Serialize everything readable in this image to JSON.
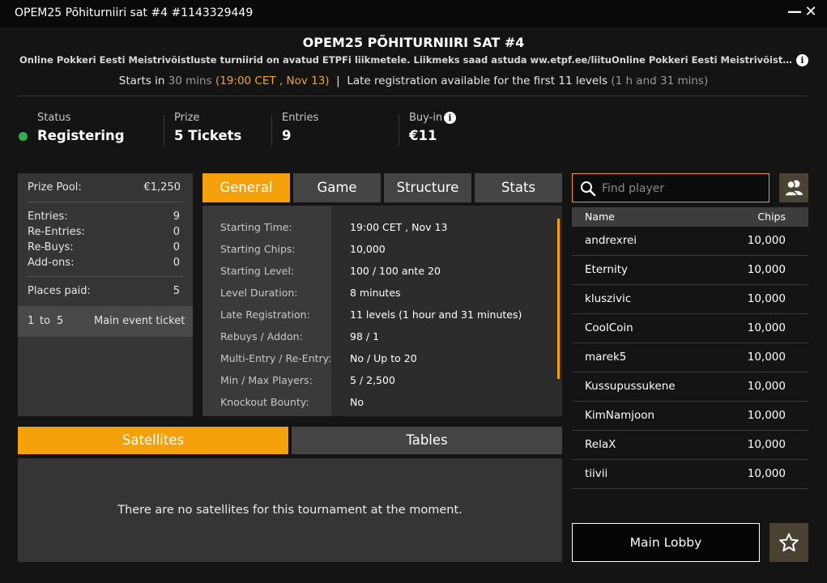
{
  "window": {
    "title": "OPEM25 Põhiturniiri sat #4 #1143329449",
    "minimize": "—",
    "close": "✕"
  },
  "header": {
    "title": "OPEM25 PÕHITURNIIRI SAT #4",
    "description": "Online Pokkeri Eesti Meistrivõistluste turniirid on avatud ETPFi liikmetele. Liikmeks saad astuda ww.etpf.ee/liituOnline Pokkeri Eesti Meistrivõistluste turniirid on avatud ETPFi liikmetele.",
    "starts_label": "Starts in",
    "starts_in": "30 mins",
    "start_time": "(19:00 CET , Nov 13)",
    "divider": "|",
    "late_reg_text": "Late registration available for the first 11 levels",
    "late_reg_time": "(1 h and 31 mins)"
  },
  "summary": {
    "status_label": "Status",
    "status_value": "Registering",
    "status_color": "#2bb24c",
    "prize_label": "Prize",
    "prize_value": "5 Tickets",
    "entries_label": "Entries",
    "entries_value": "9",
    "buyin_label": "Buy-in",
    "buyin_value": "€11"
  },
  "prize_pool": {
    "label": "Prize Pool:",
    "value": "€1,250",
    "entries_label": "Entries:",
    "entries_value": "9",
    "reentries_label": "Re-Entries:",
    "reentries_value": "0",
    "rebuys_label": "Re-Buys:",
    "rebuys_value": "0",
    "addons_label": "Add-ons:",
    "addons_value": "0",
    "places_label": "Places paid:",
    "places_value": "5",
    "place_range_from": "1",
    "place_range_to_word": "to",
    "place_range_to": "5",
    "place_prize": "Main event ticket"
  },
  "tabs": [
    {
      "label": "General",
      "active": true
    },
    {
      "label": "Game",
      "active": false
    },
    {
      "label": "Structure",
      "active": false
    },
    {
      "label": "Stats",
      "active": false
    }
  ],
  "general": [
    {
      "label": "Starting Time:",
      "value": "19:00 CET , Nov 13"
    },
    {
      "label": "Starting Chips:",
      "value": "10,000"
    },
    {
      "label": "Starting Level:",
      "value": "100 / 100 ante 20"
    },
    {
      "label": "Level Duration:",
      "value": "8 minutes"
    },
    {
      "label": "Late Registration:",
      "value": "11 levels (1 hour and 31 minutes)"
    },
    {
      "label": "Rebuys / Addon:",
      "value": "98 / 1"
    },
    {
      "label": "Multi-Entry / Re-Entry:",
      "value": "No / Up to 20"
    },
    {
      "label": "Min / Max Players:",
      "value": "5 / 2,500"
    },
    {
      "label": "Knockout Bounty:",
      "value": "No"
    }
  ],
  "bottom_tabs": [
    {
      "label": "Satellites",
      "active": true
    },
    {
      "label": "Tables",
      "active": false
    }
  ],
  "satellites": {
    "empty_message": "There are no satellites for this tournament at the moment."
  },
  "search": {
    "placeholder": "Find player",
    "value": ""
  },
  "players": {
    "col_name": "Name",
    "col_chips": "Chips",
    "rows": [
      {
        "name": "andrexrei",
        "chips": "10,000"
      },
      {
        "name": "Eternity",
        "chips": "10,000"
      },
      {
        "name": "kluszivic",
        "chips": "10,000"
      },
      {
        "name": "CoolCoin",
        "chips": "10,000"
      },
      {
        "name": "marek5",
        "chips": "10,000"
      },
      {
        "name": "Kussupussukene",
        "chips": "10,000"
      },
      {
        "name": "KimNamjoon",
        "chips": "10,000"
      },
      {
        "name": "RelaX",
        "chips": "10,000"
      },
      {
        "name": "tiivii",
        "chips": "10,000"
      }
    ]
  },
  "footer": {
    "main_lobby_label": "Main Lobby"
  },
  "icons": {
    "info": "info-icon",
    "search": "search-icon",
    "friends": "friends-icon",
    "favorite": "star-icon",
    "status": "status-dot-icon"
  },
  "colors": {
    "accent": "#f5a10b",
    "status_green": "#2bb24c",
    "button_brown": "#4a4233"
  }
}
